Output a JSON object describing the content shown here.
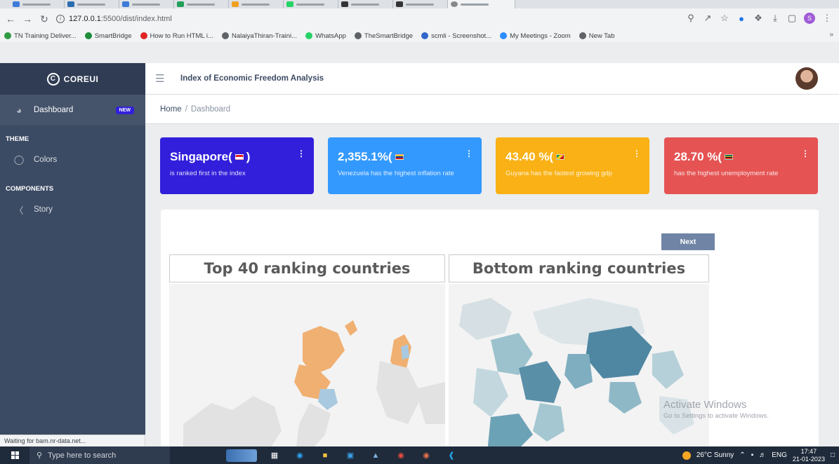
{
  "browser": {
    "url_host": "127.0.0.1",
    "url_rest": ":5500/dist/index.html",
    "bookmarks": [
      {
        "label": "TN Training Deliver...",
        "color": "#2e9b42"
      },
      {
        "label": "SmartBridge",
        "color": "#1e8c3a"
      },
      {
        "label": "How to Run HTML i...",
        "color": "#e02424"
      },
      {
        "label": "NalaiyaThiran-Traini...",
        "color": "#5f6368"
      },
      {
        "label": "WhatsApp",
        "color": "#25d366"
      },
      {
        "label": "TheSmartBridge",
        "color": "#5f6368"
      },
      {
        "label": "scmli - Screenshot...",
        "color": "#3366cc"
      },
      {
        "label": "My Meetings - Zoom",
        "color": "#2d8cff"
      },
      {
        "label": "New Tab",
        "color": "#5f6368"
      }
    ],
    "bookmarks_more": "»",
    "profile_initial": "S",
    "status_text": "Waiting for bam.nr-data.net..."
  },
  "sidebar": {
    "brand": "COREUI",
    "dashboard_label": "Dashboard",
    "dashboard_badge": "NEW",
    "theme_title": "THEME",
    "colors_label": "Colors",
    "components_title": "COMPONENTS",
    "story_label": "Story"
  },
  "header": {
    "title": "Index of Economic Freedom Analysis"
  },
  "breadcrumb": {
    "home": "Home",
    "separator": "/",
    "current": "Dashboard"
  },
  "widgets": [
    {
      "value": "Singapore(",
      "value_suffix": ")",
      "text": "is ranked first in the index",
      "color": "#321fdb"
    },
    {
      "value": "2,355.1%(",
      "value_suffix": "",
      "text": "Venezuela has the highest inflation rate",
      "color": "#3399ff"
    },
    {
      "value": "43.40 %(",
      "value_suffix": "",
      "text": "Guyana has the fastest growing gdp",
      "color": "#f9b115"
    },
    {
      "value": "28.70 %(",
      "value_suffix": "",
      "text": "has the highest unemployment rate",
      "color": "#e55353"
    }
  ],
  "main": {
    "next_label": "Next",
    "chart_left_title": "Top 40 ranking countries",
    "chart_right_title": "Bottom ranking countries"
  },
  "activate": {
    "line1": "Activate Windows",
    "line2": "Go to Settings to activate Windows."
  },
  "taskbar": {
    "search_placeholder": "Type here to search",
    "weather": "26°C  Sunny",
    "lang": "ENG",
    "time": "17:47",
    "date": "21-01-2023"
  }
}
